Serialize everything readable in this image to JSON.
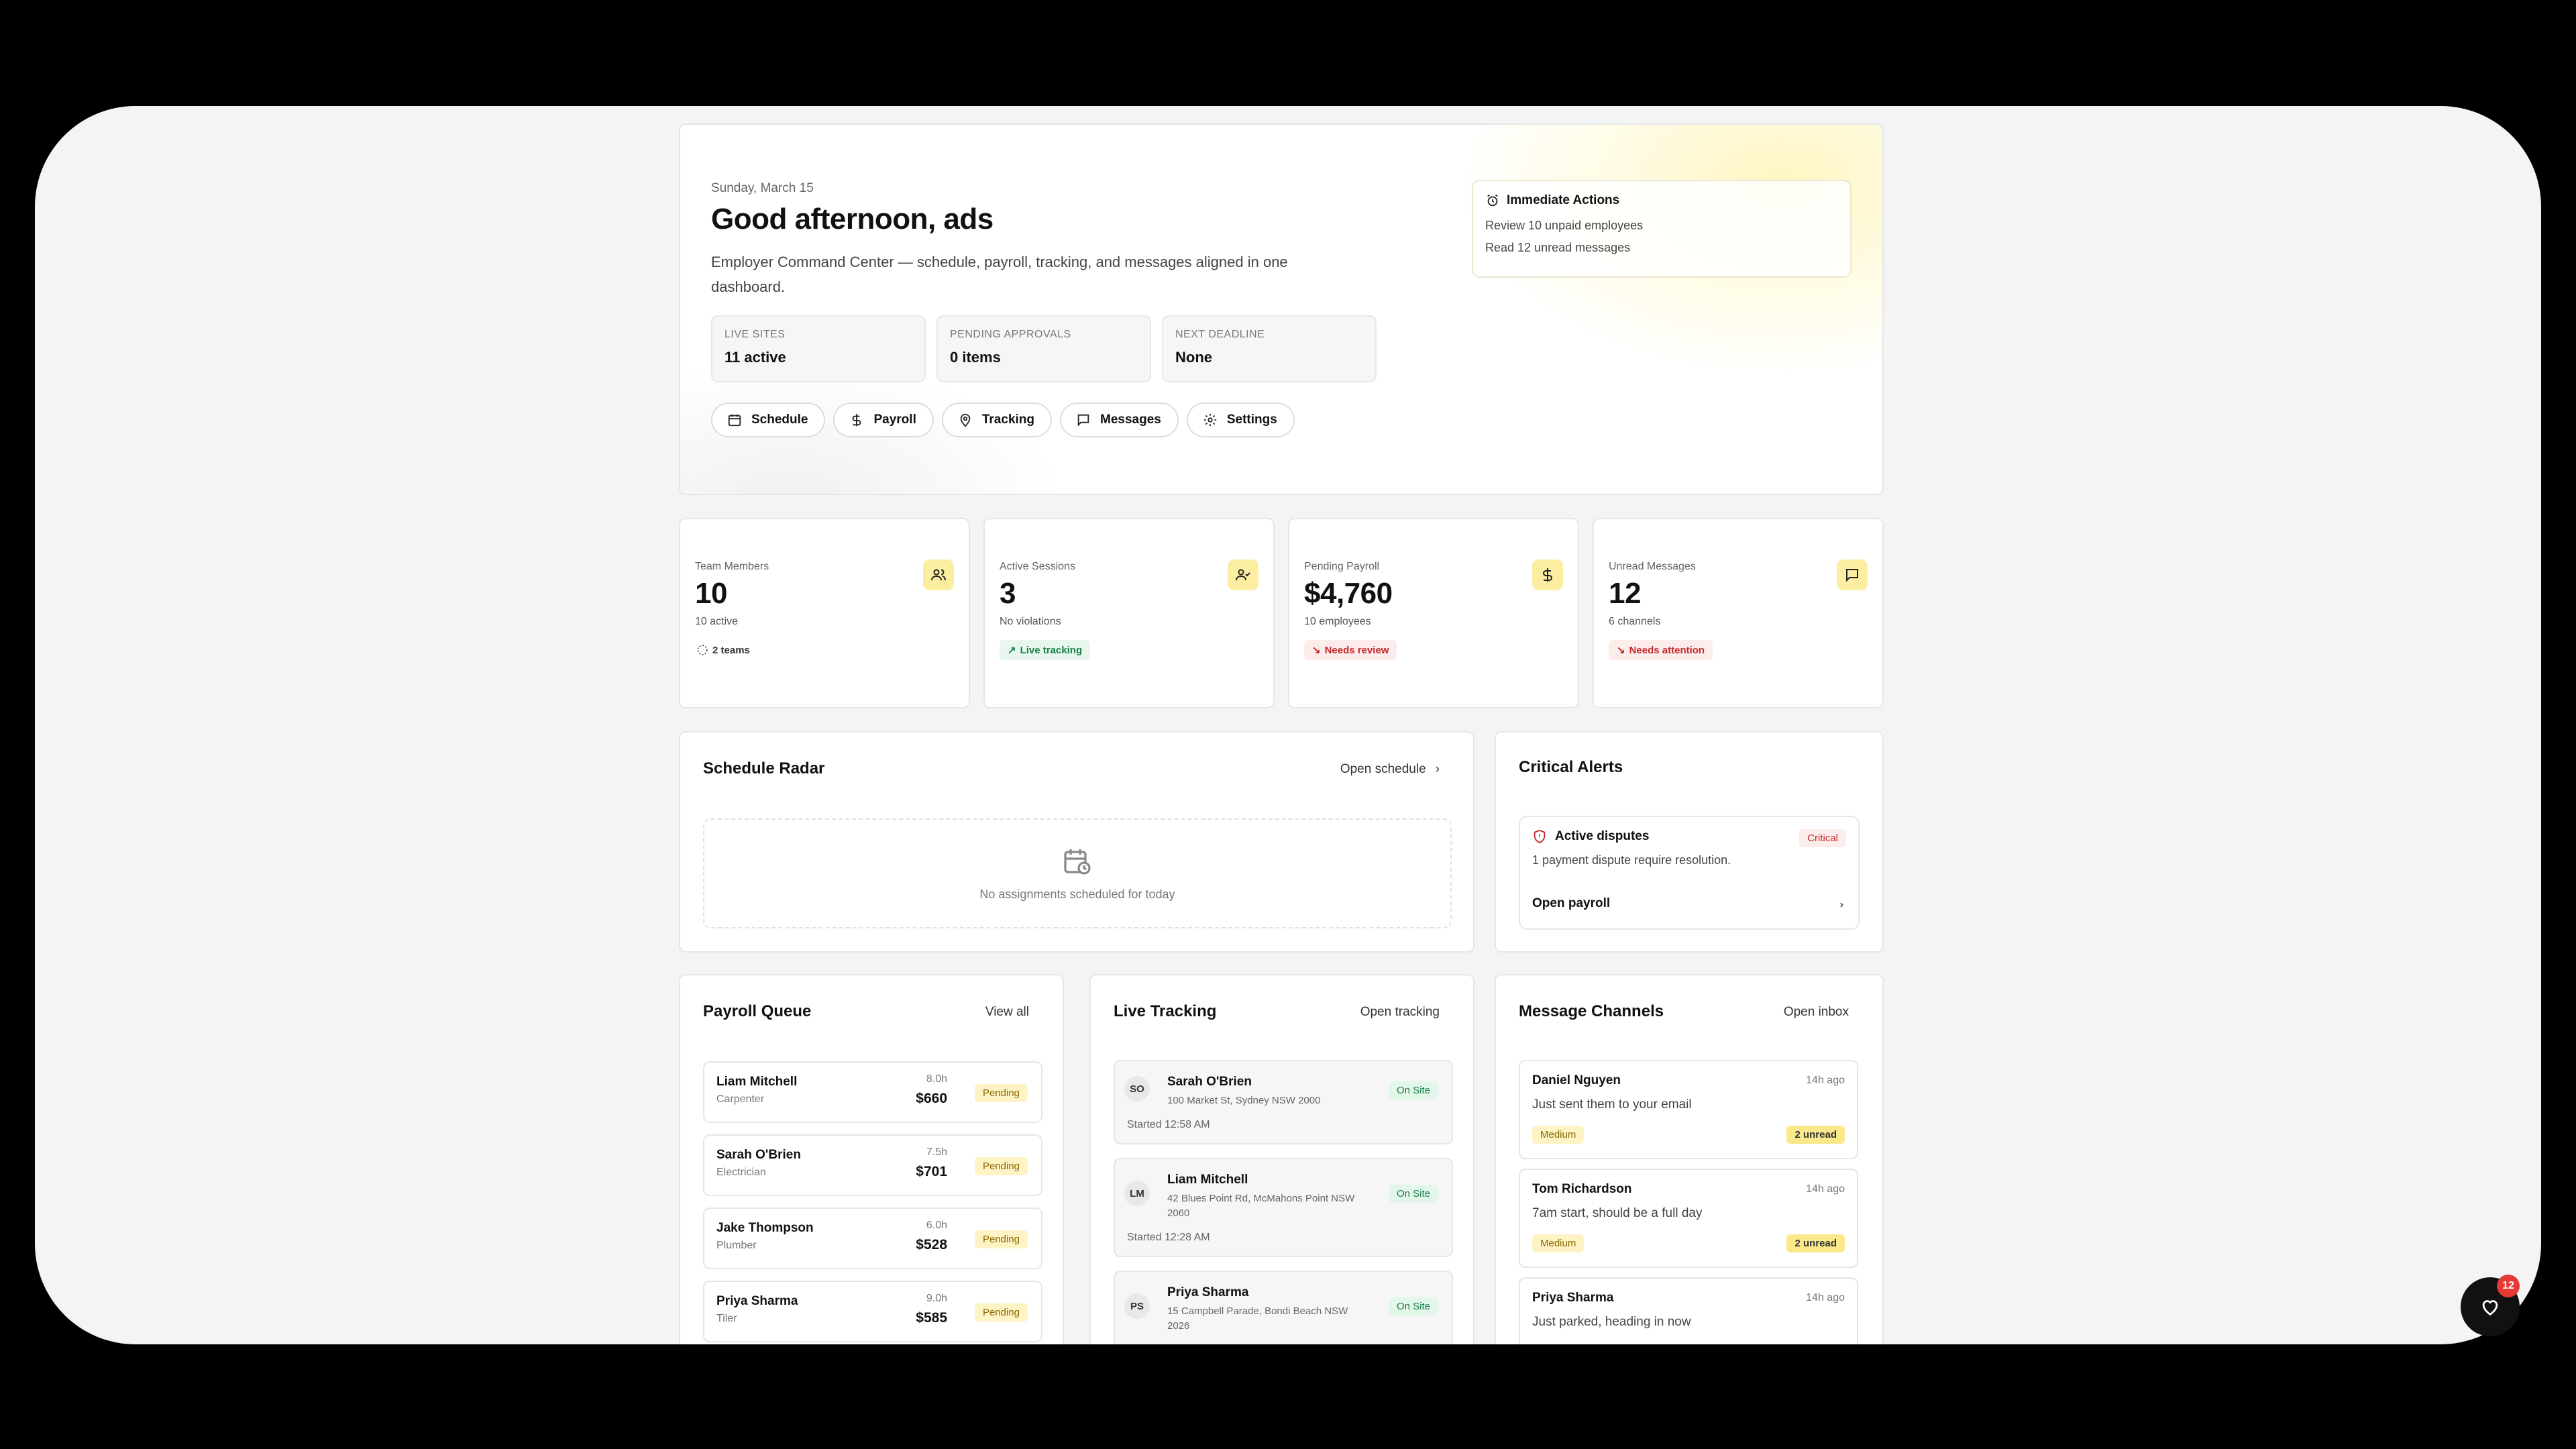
{
  "hero": {
    "date": "Sunday, March 15",
    "greeting": "Good afternoon, ads",
    "subtitle": "Employer Command Center — schedule, payroll, tracking, and messages aligned in one dashboard.",
    "stats": [
      {
        "label": "LIVE SITES",
        "value": "11 active"
      },
      {
        "label": "PENDING APPROVALS",
        "value": "0 items"
      },
      {
        "label": "NEXT DEADLINE",
        "value": "None"
      }
    ],
    "nav": [
      {
        "label": "Schedule",
        "icon": "calendar-icon"
      },
      {
        "label": "Payroll",
        "icon": "dollar-icon"
      },
      {
        "label": "Tracking",
        "icon": "location-pin-icon"
      },
      {
        "label": "Messages",
        "icon": "message-icon"
      },
      {
        "label": "Settings",
        "icon": "gear-icon"
      }
    ],
    "immediate": {
      "title": "Immediate Actions",
      "items": [
        "Review 10 unpaid employees",
        "Read 12 unread messages"
      ]
    }
  },
  "kpis": [
    {
      "label": "Team Members",
      "value": "10",
      "sub": "10 active",
      "badge": "2 teams",
      "icon": "users-icon"
    },
    {
      "label": "Active Sessions",
      "value": "3",
      "sub": "No violations",
      "badge": "Live tracking",
      "icon": "user-check-icon"
    },
    {
      "label": "Pending Payroll",
      "value": "$4,760",
      "sub": "10 employees",
      "badge": "Needs review",
      "icon": "dollar-icon"
    },
    {
      "label": "Unread Messages",
      "value": "12",
      "sub": "6 channels",
      "badge": "Needs attention",
      "icon": "message-icon"
    }
  ],
  "radar": {
    "title": "Schedule Radar",
    "link": "Open schedule",
    "empty": "No assignments scheduled for today"
  },
  "alerts": {
    "title": "Critical Alerts",
    "item_title": "Active disputes",
    "severity": "Critical",
    "desc": "1 payment dispute require resolution.",
    "action": "Open payroll"
  },
  "payroll": {
    "title": "Payroll Queue",
    "link": "View all",
    "rows": [
      {
        "name": "Liam Mitchell",
        "role": "Carpenter",
        "hours": "8.0h",
        "amount": "$660",
        "status": "Pending"
      },
      {
        "name": "Sarah O'Brien",
        "role": "Electrician",
        "hours": "7.5h",
        "amount": "$701",
        "status": "Pending"
      },
      {
        "name": "Jake Thompson",
        "role": "Plumber",
        "hours": "6.0h",
        "amount": "$528",
        "status": "Pending"
      },
      {
        "name": "Priya Sharma",
        "role": "Tiler",
        "hours": "9.0h",
        "amount": "$585",
        "status": "Pending"
      }
    ]
  },
  "live": {
    "title": "Live Tracking",
    "link": "Open tracking",
    "rows": [
      {
        "initials": "SO",
        "name": "Sarah O'Brien",
        "address": "100 Market St, Sydney NSW 2000",
        "started": "Started 12:58 AM",
        "status": "On Site"
      },
      {
        "initials": "LM",
        "name": "Liam Mitchell",
        "address": "42 Blues Point Rd, McMahons Point NSW 2060",
        "started": "Started 12:28 AM",
        "status": "On Site"
      },
      {
        "initials": "PS",
        "name": "Priya Sharma",
        "address": "15 Campbell Parade, Bondi Beach NSW 2026",
        "started": "",
        "status": "On Site"
      }
    ]
  },
  "messages": {
    "title": "Message Channels",
    "link": "Open inbox",
    "rows": [
      {
        "name": "Daniel Nguyen",
        "time": "14h ago",
        "preview": "Just sent them to your email",
        "priority": "Medium",
        "unread": "2 unread"
      },
      {
        "name": "Tom Richardson",
        "time": "14h ago",
        "preview": "7am start, should be a full day",
        "priority": "Medium",
        "unread": "2 unread"
      },
      {
        "name": "Priya Sharma",
        "time": "14h ago",
        "preview": "Just parked, heading in now",
        "priority": "",
        "unread": ""
      }
    ]
  },
  "fab": {
    "badge": "12",
    "icon": "heart-icon"
  },
  "colors": {
    "accent": "#fbeea0",
    "success": "#1a7f48",
    "danger": "#c62828",
    "background": "#f4f4f4"
  }
}
